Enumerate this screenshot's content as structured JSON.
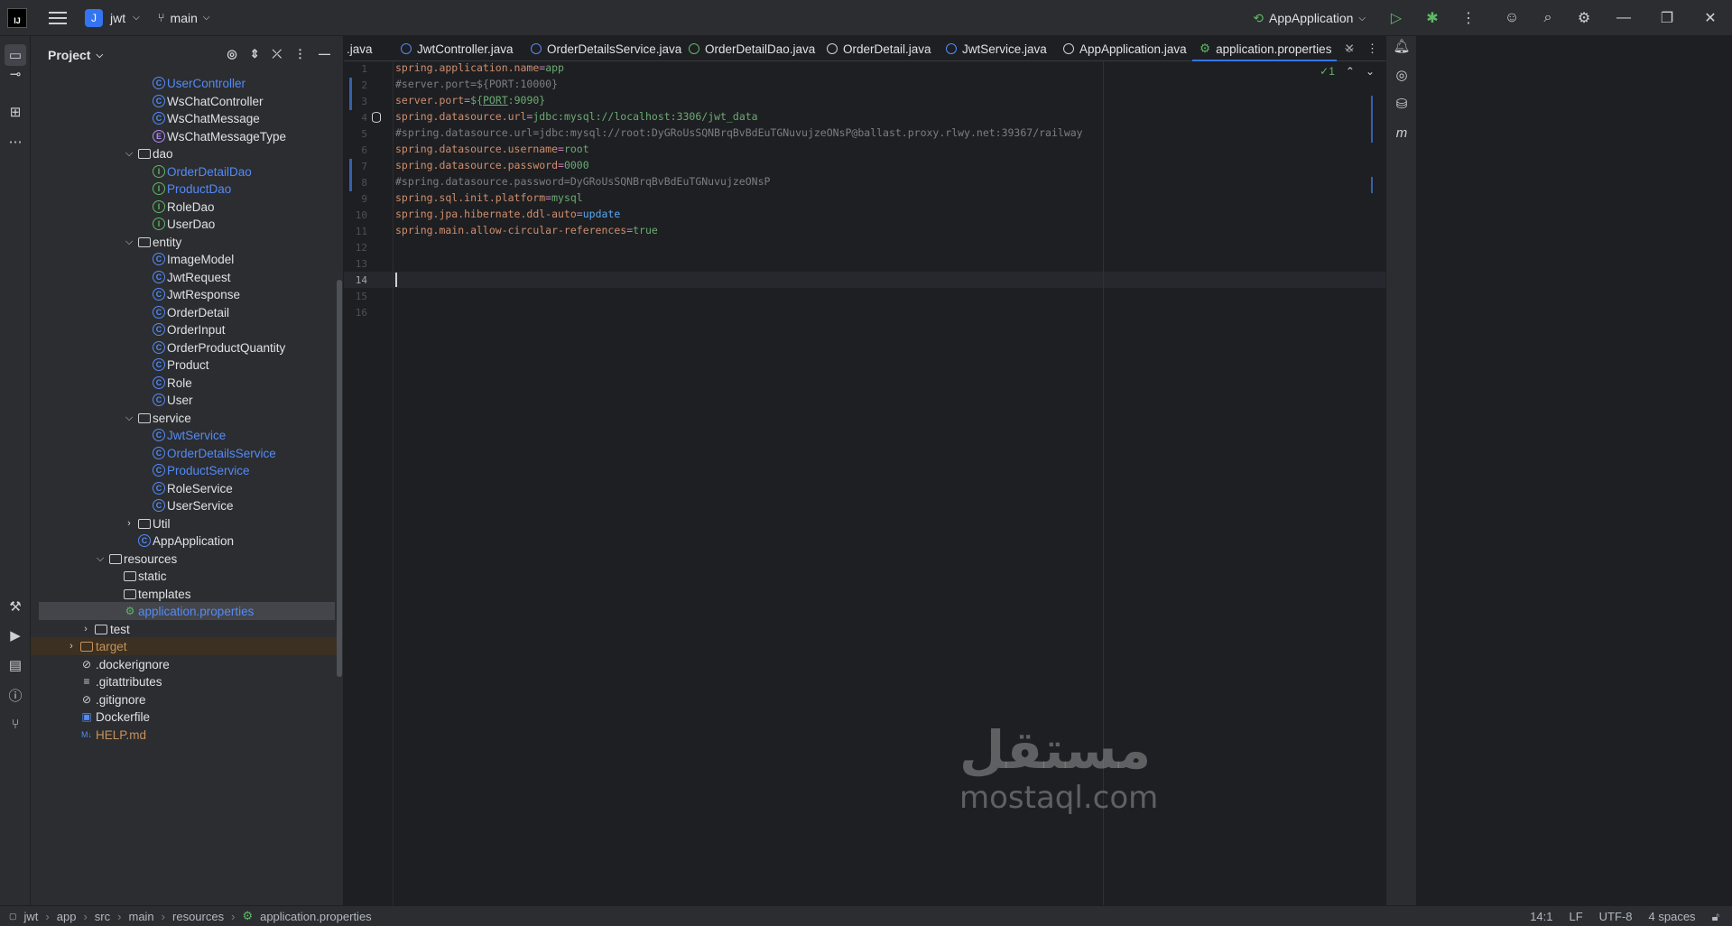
{
  "titlebar": {
    "project_badge": "J",
    "project_name": "jwt",
    "branch": "main",
    "run_config": "AppApplication"
  },
  "project_panel": {
    "title": "Project",
    "items": [
      {
        "label": "UserController",
        "type": "class",
        "color": "blue"
      },
      {
        "label": "WsChatController",
        "type": "class"
      },
      {
        "label": "WsChatMessage",
        "type": "class"
      },
      {
        "label": "WsChatMessageType",
        "type": "enum"
      },
      {
        "label": "dao",
        "type": "folder",
        "expanded": true
      },
      {
        "label": "OrderDetailDao",
        "type": "interface",
        "color": "blue"
      },
      {
        "label": "ProductDao",
        "type": "interface",
        "color": "blue"
      },
      {
        "label": "RoleDao",
        "type": "interface"
      },
      {
        "label": "UserDao",
        "type": "interface"
      },
      {
        "label": "entity",
        "type": "folder",
        "expanded": true
      },
      {
        "label": "ImageModel",
        "type": "class"
      },
      {
        "label": "JwtRequest",
        "type": "class"
      },
      {
        "label": "JwtResponse",
        "type": "class"
      },
      {
        "label": "OrderDetail",
        "type": "class"
      },
      {
        "label": "OrderInput",
        "type": "class"
      },
      {
        "label": "OrderProductQuantity",
        "type": "class"
      },
      {
        "label": "Product",
        "type": "class"
      },
      {
        "label": "Role",
        "type": "class"
      },
      {
        "label": "User",
        "type": "class"
      },
      {
        "label": "service",
        "type": "folder",
        "expanded": true
      },
      {
        "label": "JwtService",
        "type": "class",
        "color": "blue"
      },
      {
        "label": "OrderDetailsService",
        "type": "class",
        "color": "blue"
      },
      {
        "label": "ProductService",
        "type": "class",
        "color": "blue"
      },
      {
        "label": "RoleService",
        "type": "class"
      },
      {
        "label": "UserService",
        "type": "class"
      },
      {
        "label": "Util",
        "type": "folder",
        "expanded": false
      },
      {
        "label": "AppApplication",
        "type": "class"
      },
      {
        "label": "resources",
        "type": "folder",
        "expanded": true
      },
      {
        "label": "static",
        "type": "folder"
      },
      {
        "label": "templates",
        "type": "folder"
      },
      {
        "label": "application.properties",
        "type": "properties",
        "color": "blue",
        "selected": true
      },
      {
        "label": "test",
        "type": "folder",
        "expanded": false
      },
      {
        "label": "target",
        "type": "folder",
        "expanded": false,
        "color": "orange"
      },
      {
        "label": ".dockerignore",
        "type": "ignore"
      },
      {
        "label": ".gitattributes",
        "type": "text"
      },
      {
        "label": ".gitignore",
        "type": "ignore"
      },
      {
        "label": "Dockerfile",
        "type": "docker"
      },
      {
        "label": "HELP.md",
        "type": "markdown",
        "color": "orange"
      }
    ]
  },
  "tabs": [
    {
      "label": ".java",
      "icon": "none"
    },
    {
      "label": "JwtController.java",
      "icon": "class"
    },
    {
      "label": "OrderDetailsService.java",
      "icon": "class"
    },
    {
      "label": "OrderDetailDao.java",
      "icon": "interface"
    },
    {
      "label": "OrderDetail.java",
      "icon": "class"
    },
    {
      "label": "JwtService.java",
      "icon": "class"
    },
    {
      "label": "AppApplication.java",
      "icon": "spring"
    },
    {
      "label": "application.properties",
      "icon": "properties",
      "active": true
    }
  ],
  "editor": {
    "inspection_count": "1",
    "lines": [
      {
        "n": "1",
        "key": "spring.application.name",
        "value": "app"
      },
      {
        "n": "2",
        "comment": "#server.port=${PORT:10000}"
      },
      {
        "n": "3",
        "key": "server.port",
        "value_prefix": "${",
        "value_mid": "PORT",
        "value_suffix": ":9090}"
      },
      {
        "n": "4",
        "key": "spring.datasource.url",
        "value": "jdbc:mysql://localhost:3306/jwt_data"
      },
      {
        "n": "5",
        "comment": "#spring.datasource.url=jdbc:mysql://root:DyGRoUsSQNBrqBvBdEuTGNuvujzeONsP@ballast.proxy.rlwy.net:39367/railway"
      },
      {
        "n": "6",
        "key": "spring.datasource.username",
        "value": "root"
      },
      {
        "n": "7",
        "key": "spring.datasource.password",
        "value": "0000"
      },
      {
        "n": "8",
        "comment": "#spring.datasource.password=DyGRoUsSQNBrqBvBdEuTGNuvujzeONsP"
      },
      {
        "n": "9",
        "key": "spring.sql.init.platform",
        "value": "mysql"
      },
      {
        "n": "10",
        "key": "spring.jpa.hibernate.ddl-auto",
        "value": "update",
        "value_color": "blue"
      },
      {
        "n": "11",
        "key": "spring.main.allow-circular-references",
        "value": "true"
      },
      {
        "n": "12"
      },
      {
        "n": "13"
      },
      {
        "n": "14",
        "current": true
      },
      {
        "n": "15"
      },
      {
        "n": "16"
      }
    ]
  },
  "watermark": {
    "arabic": "مستقل",
    "latin": "mostaql.com"
  },
  "statusbar": {
    "crumbs": [
      "jwt",
      "app",
      "src",
      "main",
      "resources",
      "application.properties"
    ],
    "position": "14:1",
    "line_sep": "LF",
    "encoding": "UTF-8",
    "indent": "4 spaces"
  }
}
